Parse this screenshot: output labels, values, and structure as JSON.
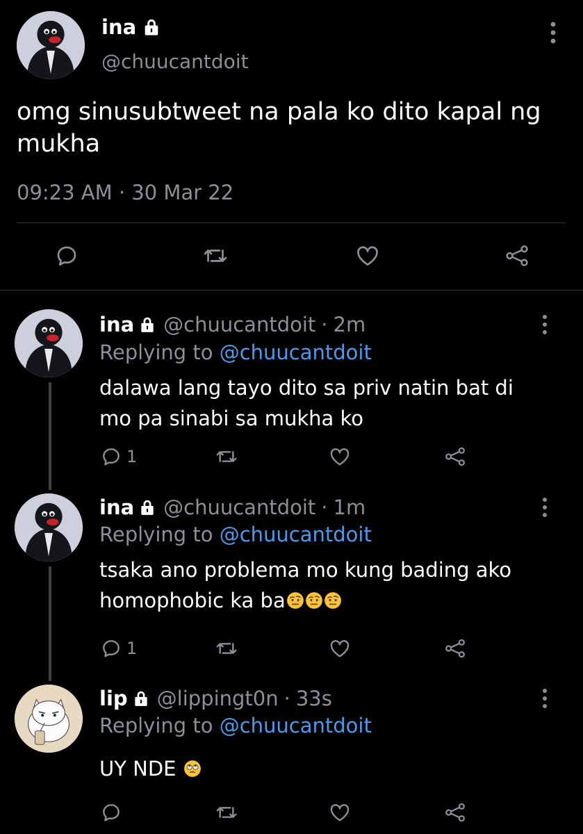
{
  "main_tweet": {
    "name": "ina",
    "handle": "@chuucantdoit",
    "text": "omg sinusubtweet na pala ko dito kapal ng mukha",
    "timestamp": "09:23 AM · 30 Mar 22",
    "icons": [
      "lock-icon",
      "more-icon",
      "reply-icon",
      "retweet-icon",
      "like-icon",
      "share-icon"
    ]
  },
  "replies": [
    {
      "name": "ina",
      "handle": "@chuucantdoit",
      "separator": "·",
      "age": "2m",
      "replying_prefix": "Replying to",
      "replying_to": "@chuucantdoit",
      "text": "dalawa lang tayo dito sa priv natin bat di mo pa sinabi sa mukha ko",
      "reply_count": "1"
    },
    {
      "name": "ina",
      "handle": "@chuucantdoit",
      "separator": "·",
      "age": "1m",
      "replying_prefix": "Replying to",
      "replying_to": "@chuucantdoit",
      "text": "tsaka ano problema mo kung bading ako homophobic ka ba",
      "emojis": [
        "raised-eyebrow-emoji",
        "raised-eyebrow-emoji",
        "raised-eyebrow-emoji"
      ],
      "reply_count": "1"
    },
    {
      "name": "lip",
      "handle": "@lippingt0n",
      "separator": "·",
      "age": "33s",
      "replying_prefix": "Replying to",
      "replying_to": "@chuucantdoit",
      "text": "UY NDE",
      "emojis": [
        "eye-roll-emoji"
      ],
      "reply_count": ""
    }
  ],
  "colors": {
    "background": "#000000",
    "text": "#ffffff",
    "secondary_text": "#8b9096",
    "mention": "#4c9aeb",
    "divider": "#2f3336",
    "thread_line": "#3e4144"
  }
}
